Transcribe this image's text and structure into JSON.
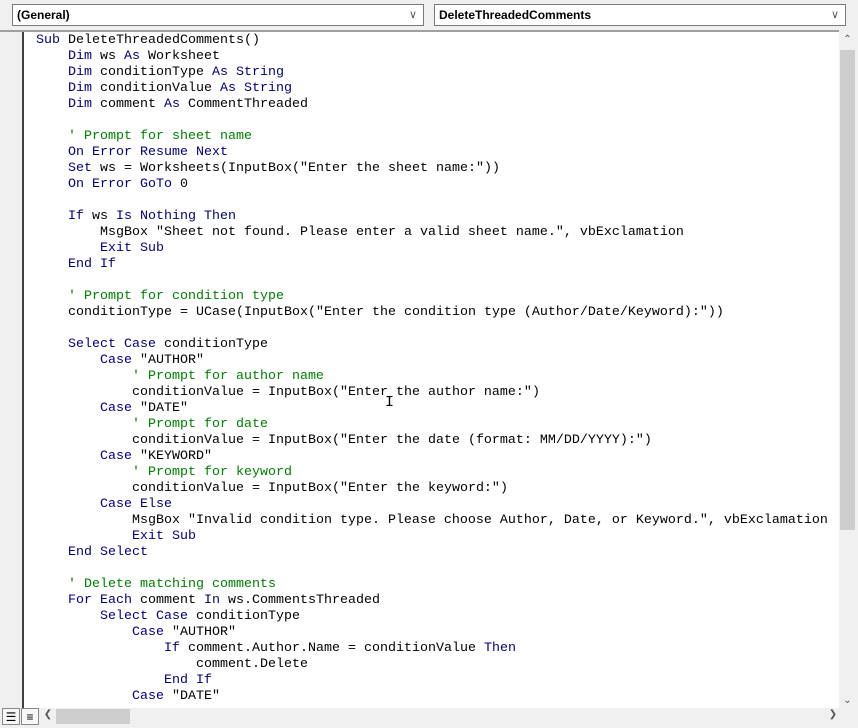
{
  "header": {
    "object_dropdown": "(General)",
    "procedure_dropdown": "DeleteThreadedComments"
  },
  "code_lines": [
    "Sub DeleteThreadedComments()",
    "    Dim ws As Worksheet",
    "    Dim conditionType As String",
    "    Dim conditionValue As String",
    "    Dim comment As CommentThreaded",
    "",
    "    ' Prompt for sheet name",
    "    On Error Resume Next",
    "    Set ws = Worksheets(InputBox(\"Enter the sheet name:\"))",
    "    On Error GoTo 0",
    "",
    "    If ws Is Nothing Then",
    "        MsgBox \"Sheet not found. Please enter a valid sheet name.\", vbExclamation",
    "        Exit Sub",
    "    End If",
    "",
    "    ' Prompt for condition type",
    "    conditionType = UCase(InputBox(\"Enter the condition type (Author/Date/Keyword):\"))",
    "",
    "    Select Case conditionType",
    "        Case \"AUTHOR\"",
    "            ' Prompt for author name",
    "            conditionValue = InputBox(\"Enter the author name:\")",
    "        Case \"DATE\"",
    "            ' Prompt for date",
    "            conditionValue = InputBox(\"Enter the date (format: MM/DD/YYYY):\")",
    "        Case \"KEYWORD\"",
    "            ' Prompt for keyword",
    "            conditionValue = InputBox(\"Enter the keyword:\")",
    "        Case Else",
    "            MsgBox \"Invalid condition type. Please choose Author, Date, or Keyword.\", vbExclamation",
    "            Exit Sub",
    "    End Select",
    "",
    "    ' Delete matching comments",
    "    For Each comment In ws.CommentsThreaded",
    "        Select Case conditionType",
    "            Case \"AUTHOR\"",
    "                If comment.Author.Name = conditionValue Then",
    "                    comment.Delete",
    "                End If",
    "            Case \"DATE\""
  ],
  "colors": {
    "keyword": "#00007f",
    "comment": "#008000",
    "text": "#000000"
  }
}
